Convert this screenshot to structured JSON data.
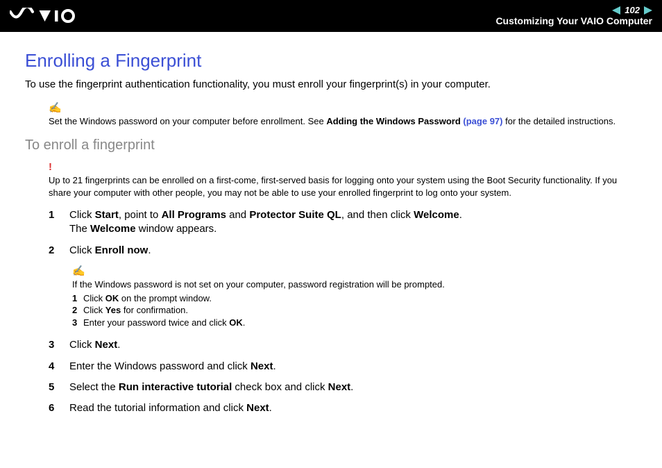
{
  "header": {
    "logo_alt": "VAIO",
    "page_number": "102",
    "section": "Customizing Your VAIO Computer"
  },
  "title": "Enrolling a Fingerprint",
  "intro": "To use the fingerprint authentication functionality, you must enroll your fingerprint(s) in your computer.",
  "note1": {
    "pre": "Set the Windows password on your computer before enrollment. See ",
    "link_text": "Adding the Windows Password",
    "link_page": "(page 97)",
    "post": " for the detailed instructions."
  },
  "subtitle": "To enroll a fingerprint",
  "warning": "Up to 21 fingerprints can be enrolled on a first-come, first-served basis for logging onto your system using the Boot Security functionality. If you share your computer with other people, you may not be able to use your enrolled fingerprint to log onto your system.",
  "steps": {
    "s1": {
      "num": "1",
      "t1": "Click ",
      "b1": "Start",
      "t2": ", point to ",
      "b2": "All Programs",
      "t3": " and ",
      "b3": "Protector Suite QL",
      "t4": ", and then click ",
      "b4": "Welcome",
      "t5": ".",
      "line2a": "The ",
      "line2b": "Welcome",
      "line2c": " window appears."
    },
    "s2": {
      "num": "2",
      "t1": "Click ",
      "b1": "Enroll now",
      "t2": "."
    },
    "note2": {
      "intro": "If the Windows password is not set on your computer, password registration will be prompted.",
      "r1n": "1",
      "r1a": "Click ",
      "r1b": "OK",
      "r1c": " on the prompt window.",
      "r2n": "2",
      "r2a": "Click ",
      "r2b": "Yes",
      "r2c": " for confirmation.",
      "r3n": "3",
      "r3a": "Enter your password twice and click ",
      "r3b": "OK",
      "r3c": "."
    },
    "s3": {
      "num": "3",
      "t1": "Click ",
      "b1": "Next",
      "t2": "."
    },
    "s4": {
      "num": "4",
      "t1": "Enter the Windows password and click ",
      "b1": "Next",
      "t2": "."
    },
    "s5": {
      "num": "5",
      "t1": "Select the ",
      "b1": "Run interactive tutorial",
      "t2": " check box and click ",
      "b2": "Next",
      "t3": "."
    },
    "s6": {
      "num": "6",
      "t1": "Read the tutorial information and click ",
      "b1": "Next",
      "t2": "."
    }
  }
}
